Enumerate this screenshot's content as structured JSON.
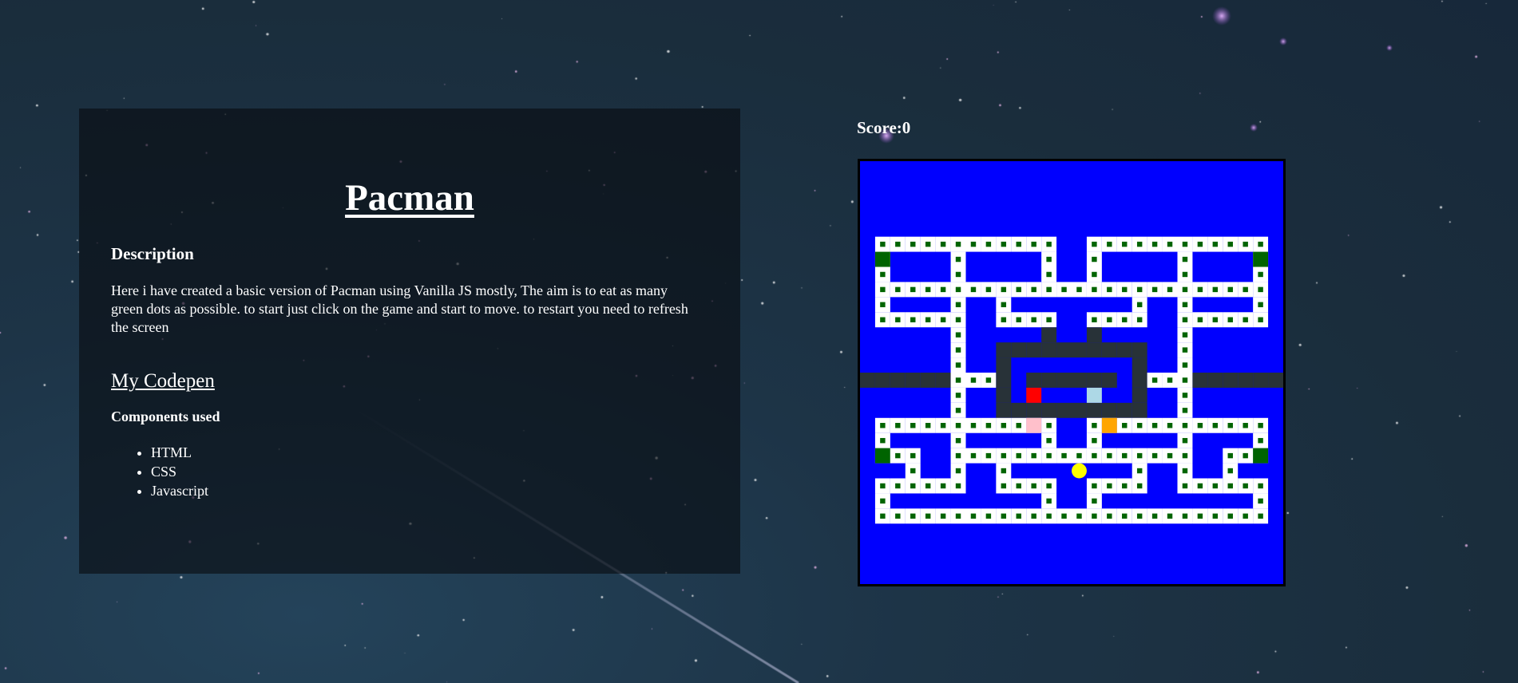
{
  "info_panel": {
    "title": "Pacman",
    "description_heading": "Description",
    "description_text": "Here i have created a basic version of Pacman using Vanilla JS mostly, The aim is to eat as many green dots as possible. to start just click on the game and start to move. to restart you need to refresh the screen",
    "codepen_link": "My Codepen",
    "components_heading": "Components used",
    "components": [
      "HTML",
      "CSS",
      "Javascript"
    ]
  },
  "game": {
    "score_label": "Score:",
    "score_value": "0",
    "grid_size": 28,
    "colors": {
      "wall": "#0000fe",
      "path": "#ffffff",
      "dot": "#006400",
      "power_pellet": "#006400",
      "ghost_lair": "#283238",
      "pacman": "#ffff00",
      "ghosts": [
        "#ff0000",
        "#add8e6",
        "#ffc0cb",
        "#ffa500"
      ]
    },
    "layout": [
      "1111111111111111111111111111",
      "1000000000000110000000000001",
      "1311110111110110111110111131",
      "1011110111110110111110111101",
      "1000000000000000000000000001",
      "1011110110111111110110111101",
      "1000000110000110000110000001",
      "1111110111114114111110111111",
      "1111110114444444444110111111",
      "1111110114222222224110111111",
      "4444440004244444424000444444",
      "1111110114222222224110111111",
      "1111110114444444444110111111",
      "1000000000000110000000000001",
      "1011110111110110111110111101",
      "1300110000000000000000110031",
      "1110110110111111110110110111",
      "1000000110000110000110000001",
      "1011111111110110111111111101",
      "1000000000000000000000000001",
      "1111111111111111111111111111"
    ],
    "pacman": {
      "row": 16,
      "col": 14
    },
    "ghost_cells": [
      {
        "name": "blinky",
        "row": 11,
        "col": 11
      },
      {
        "name": "inky",
        "row": 11,
        "col": 15
      },
      {
        "name": "pinky",
        "row": 13,
        "col": 11
      },
      {
        "name": "clyde",
        "row": 13,
        "col": 16
      }
    ]
  }
}
